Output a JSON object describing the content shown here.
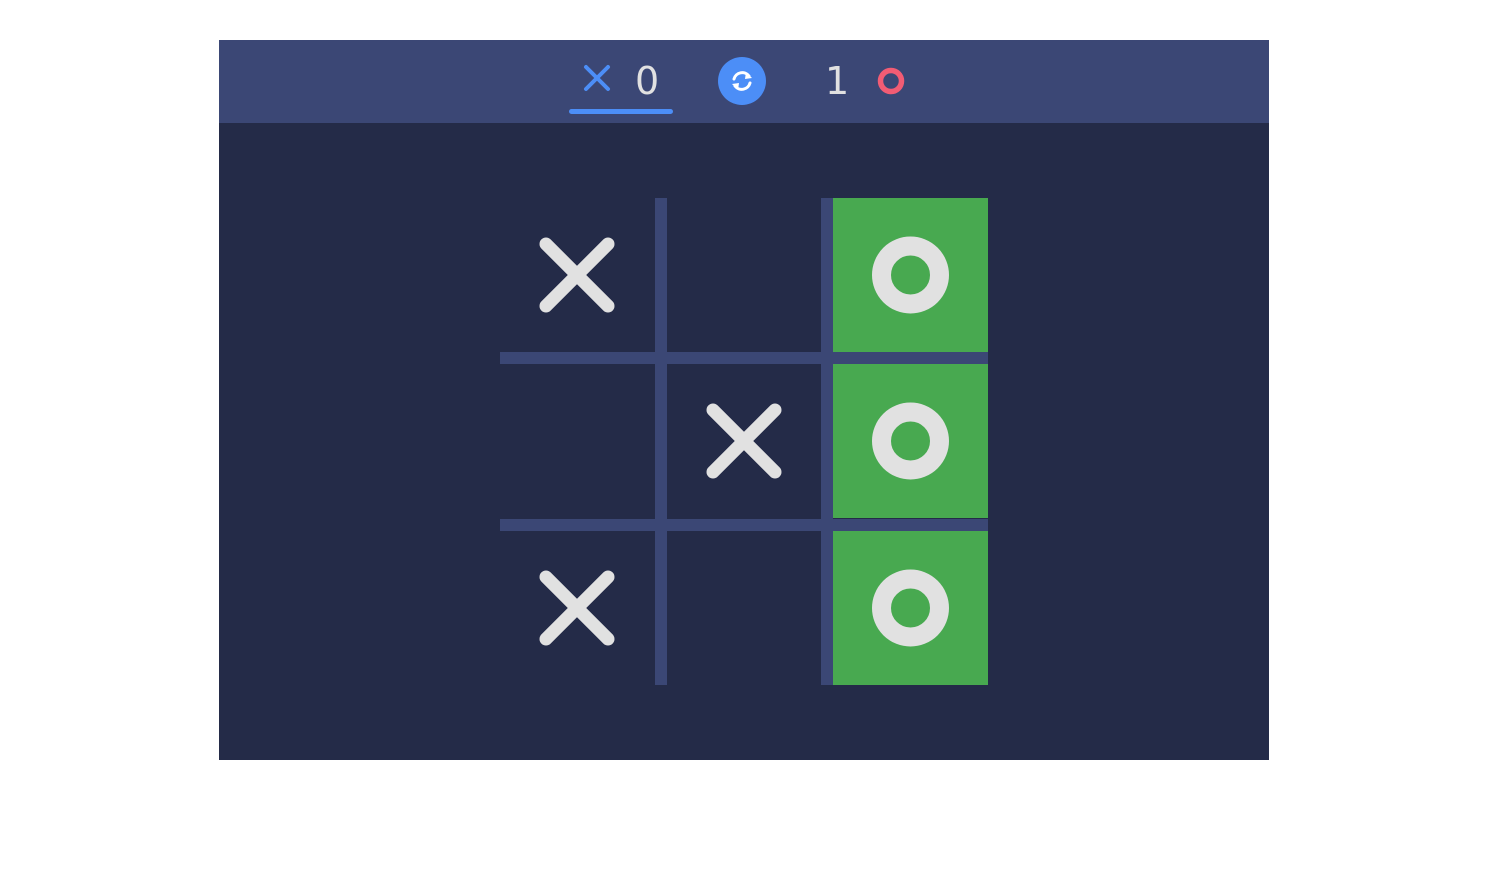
{
  "scoreboard": {
    "x_score": "0",
    "o_score": "1",
    "x_icon": "x-icon",
    "o_icon": "o-icon",
    "reset_icon": "refresh-icon",
    "active_player": "X"
  },
  "colors": {
    "background": "#242b48",
    "topbar": "#3b4775",
    "grid_line": "#3b4775",
    "x_accent": "#4c8ef7",
    "o_accent": "#f25c74",
    "mark": "#e1e1e1",
    "win_highlight": "#48a950"
  },
  "board": {
    "cells": [
      [
        "X",
        "",
        "O"
      ],
      [
        "",
        "X",
        "O"
      ],
      [
        "X",
        "",
        "O"
      ]
    ],
    "winning_cells": [
      [
        0,
        2
      ],
      [
        1,
        2
      ],
      [
        2,
        2
      ]
    ],
    "winner": "O"
  }
}
